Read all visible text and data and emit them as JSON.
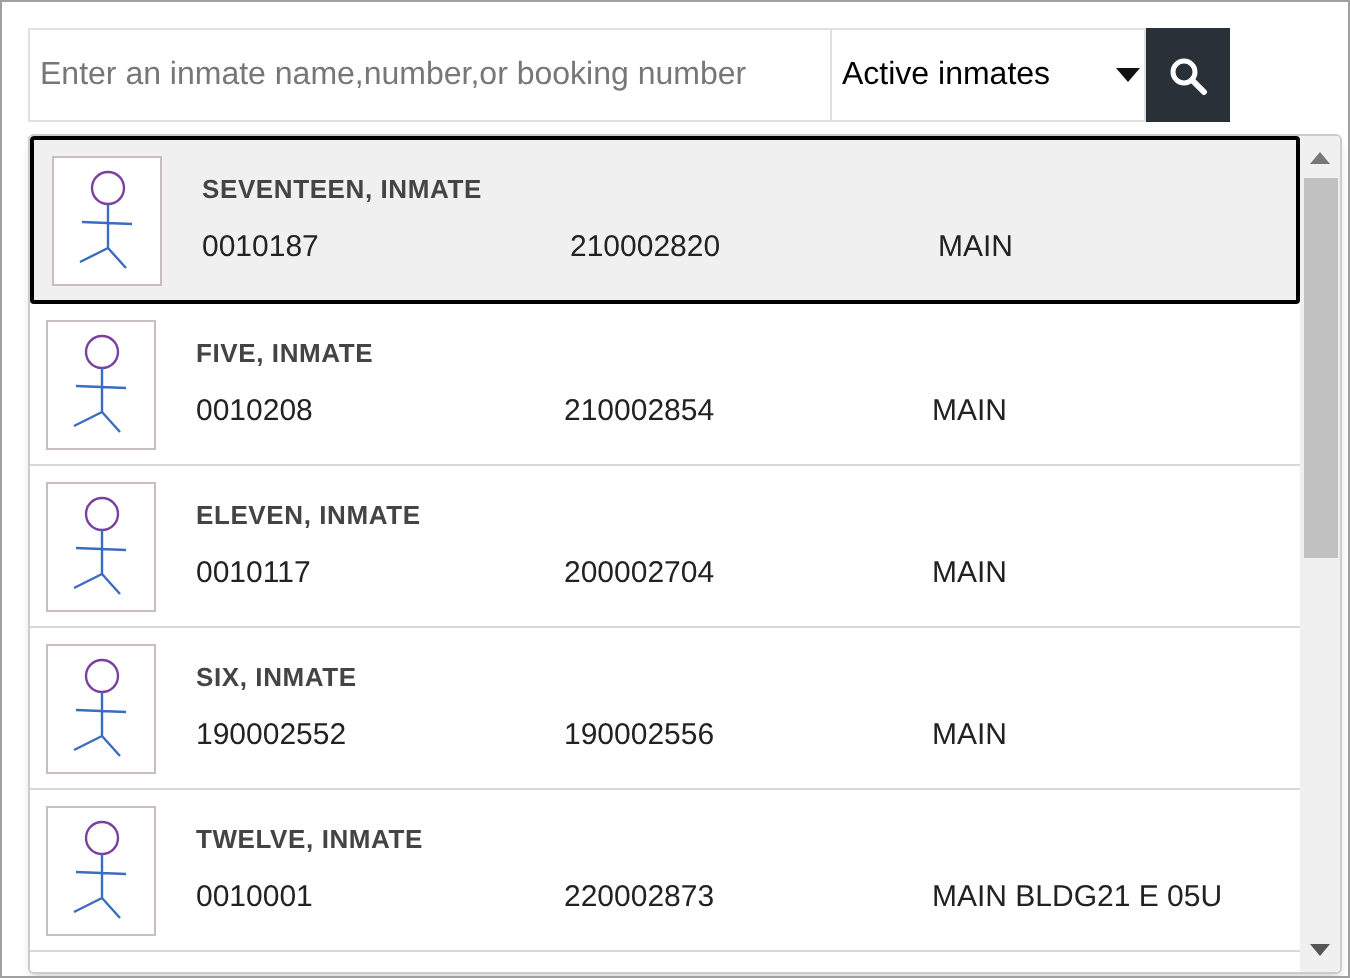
{
  "search": {
    "placeholder": "Enter an inmate name,number,or booking number"
  },
  "filter": {
    "value": "Active inmates"
  },
  "results": [
    {
      "name": "SEVENTEEN, INMATE",
      "column_1": "0010187",
      "column_2": "210002820",
      "column_3": "MAIN",
      "selected": true
    },
    {
      "name": "FIVE, INMATE",
      "column_1": "0010208",
      "column_2": "210002854",
      "column_3": "MAIN",
      "selected": false
    },
    {
      "name": "ELEVEN, INMATE",
      "column_1": "0010117",
      "column_2": "200002704",
      "column_3": "MAIN",
      "selected": false
    },
    {
      "name": "SIX, INMATE",
      "column_1": "190002552",
      "column_2": "190002556",
      "column_3": "MAIN",
      "selected": false
    },
    {
      "name": "TWELVE, INMATE",
      "column_1": "0010001",
      "column_2": "220002873",
      "column_3": "MAIN BLDG21 E 05U",
      "selected": false
    }
  ]
}
